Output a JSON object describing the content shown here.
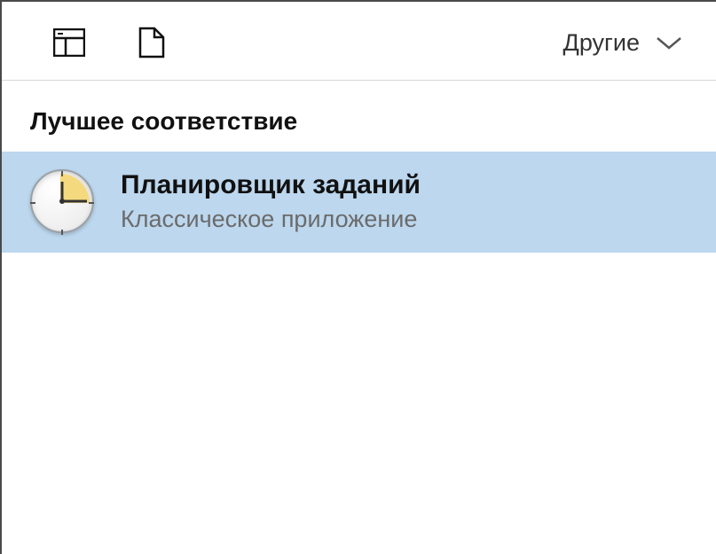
{
  "toolbar": {
    "dropdown_label": "Другие"
  },
  "section_header": "Лучшее соответствие",
  "result": {
    "title": "Планировщик заданий",
    "subtitle": "Классическое приложение"
  }
}
